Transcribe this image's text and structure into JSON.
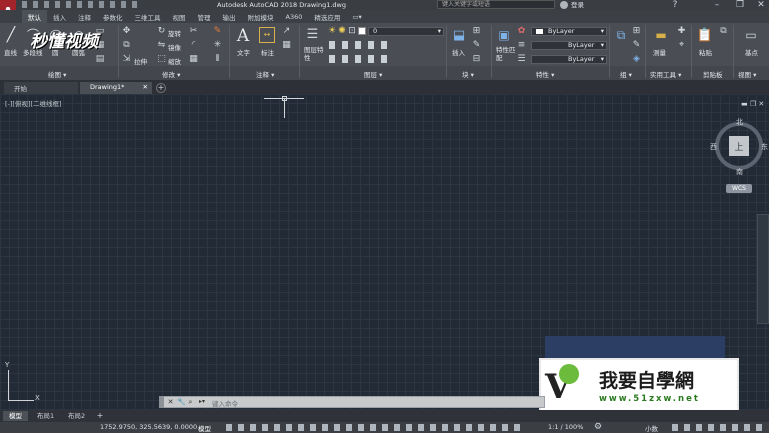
{
  "titlebar": {
    "app_title": "Autodesk AutoCAD 2018   Drawing1.dwg",
    "search_placeholder": "键入关键字或短语",
    "user": "登录"
  },
  "ribbon_tabs": [
    "默认",
    "插入",
    "注释",
    "参数化",
    "三维工具",
    "视图",
    "管理",
    "输出",
    "附加模块",
    "A360",
    "精选应用"
  ],
  "ribbon": {
    "draw": {
      "line": "直线",
      "polyline": "多段线",
      "circle": "圆",
      "arc": "圆弧"
    },
    "modify": {
      "rotate": "旋转",
      "mirror": "镜像",
      "stretch": "拉伸",
      "scale": "缩放"
    },
    "annotation": {
      "text": "文字",
      "dimension": "标注"
    },
    "layers": {
      "layer_props": "图层特性",
      "current_layer": "0"
    },
    "block": {
      "insert": "插入"
    },
    "properties": {
      "match": "特性匹配",
      "color": "ByLayer",
      "linetype": "ByLayer",
      "lineweight": "ByLayer"
    },
    "groups": {
      "group": "组"
    },
    "utilities": {
      "measure": "测量"
    },
    "clipboard": {
      "paste": "粘贴"
    },
    "view": {
      "base": "基点"
    }
  },
  "panel_titles": [
    "绘图 ▾",
    "修改 ▾",
    "注释 ▾",
    "图层 ▾",
    "块 ▾",
    "特性 ▾",
    "组 ▾",
    "实用工具 ▾",
    "剪贴板",
    "视图 ▾"
  ],
  "doc_tabs": [
    "开始",
    "Drawing1*"
  ],
  "viewport_label": "[-][俯视][二维线框]",
  "viewcube": {
    "north": "北",
    "south": "南",
    "east": "东",
    "west": "西",
    "top": "上",
    "wcs": "WCS"
  },
  "command": {
    "placeholder": "键入命令"
  },
  "layout_tabs": [
    "模型",
    "布局1",
    "布局2"
  ],
  "status": {
    "coords": "1752.9750, 325.5639, 0.0000",
    "space": "模型",
    "scale": "1:1 / 100%",
    "units": "小数"
  },
  "watermark": {
    "tl": "秒懂视频",
    "br_title": "我要自學網",
    "br_url": "www.51zxw.net"
  },
  "colors": {
    "canvas": "#222b35",
    "ribbon": "#4a4e54",
    "accent": "#c0392b"
  }
}
